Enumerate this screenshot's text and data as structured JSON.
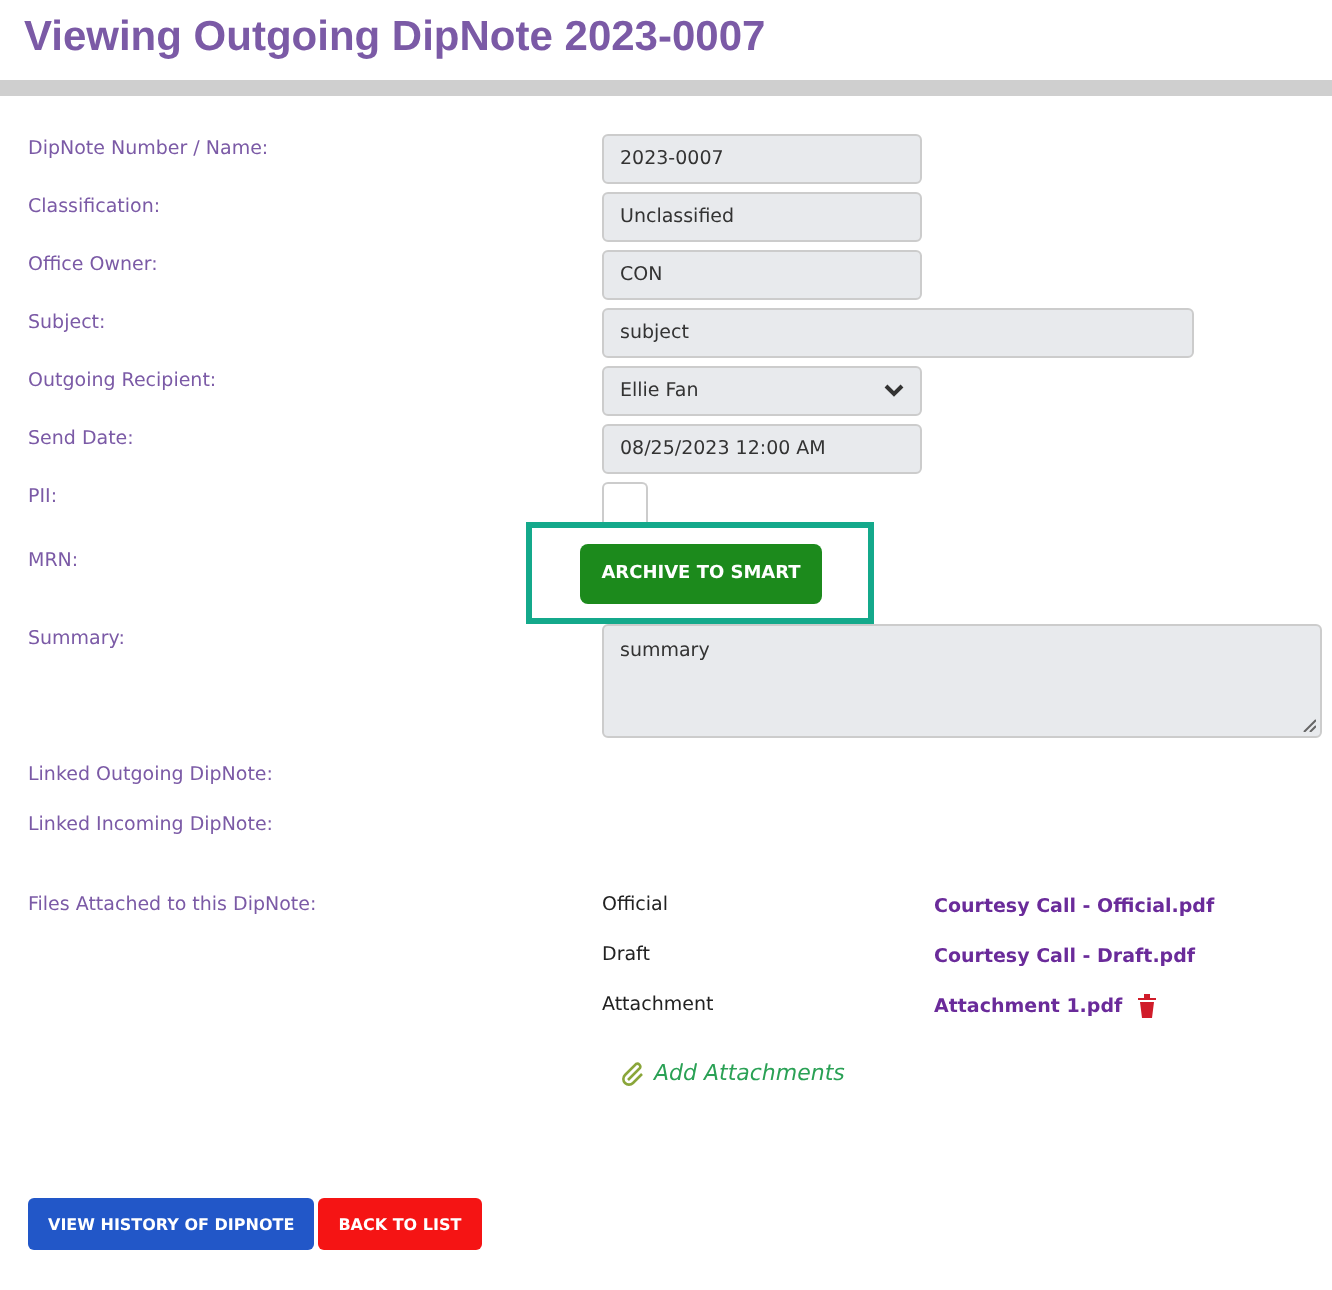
{
  "title": "Viewing Outgoing DipNote 2023-0007",
  "fields": [
    {
      "label": "DipNote Number / Name:",
      "kind": "text",
      "value": "2023-0007"
    },
    {
      "label": "Classification:",
      "kind": "text",
      "value": "Unclassified"
    },
    {
      "label": "Office Owner:",
      "kind": "text",
      "value": "CON"
    },
    {
      "label": "Subject:",
      "kind": "wide",
      "value": "subject"
    },
    {
      "label": "Outgoing Recipient:",
      "kind": "select",
      "value": "Ellie Fan"
    },
    {
      "label": "Send Date:",
      "kind": "text",
      "value": "08/25/2023  12:00  AM"
    },
    {
      "label": "PII:",
      "kind": "checkbox",
      "checked": false
    },
    {
      "label": "MRN:",
      "kind": "button",
      "value": "ARCHIVE TO SMART",
      "highlighted": true
    },
    {
      "label": "Summary:",
      "kind": "textarea",
      "value": "summary"
    },
    {
      "label": "Linked Outgoing DipNote:",
      "kind": "empty"
    },
    {
      "label": "Linked Incoming DipNote:",
      "kind": "empty"
    }
  ],
  "files": {
    "label": "Files Attached to this DipNote:",
    "rows": [
      {
        "type": "Official",
        "name": "Courtesy Call - Official.pdf",
        "deletable": false
      },
      {
        "type": "Draft",
        "name": "Courtesy Call - Draft.pdf",
        "deletable": false
      },
      {
        "type": "Attachment",
        "name": "Attachment 1.pdf",
        "deletable": true
      }
    ],
    "add": "Add Attachments"
  },
  "buttons": [
    {
      "label": "VIEW HISTORY OF DIPNOTE",
      "kind": "primary"
    },
    {
      "label": "BACK TO LIST",
      "kind": "danger"
    }
  ]
}
